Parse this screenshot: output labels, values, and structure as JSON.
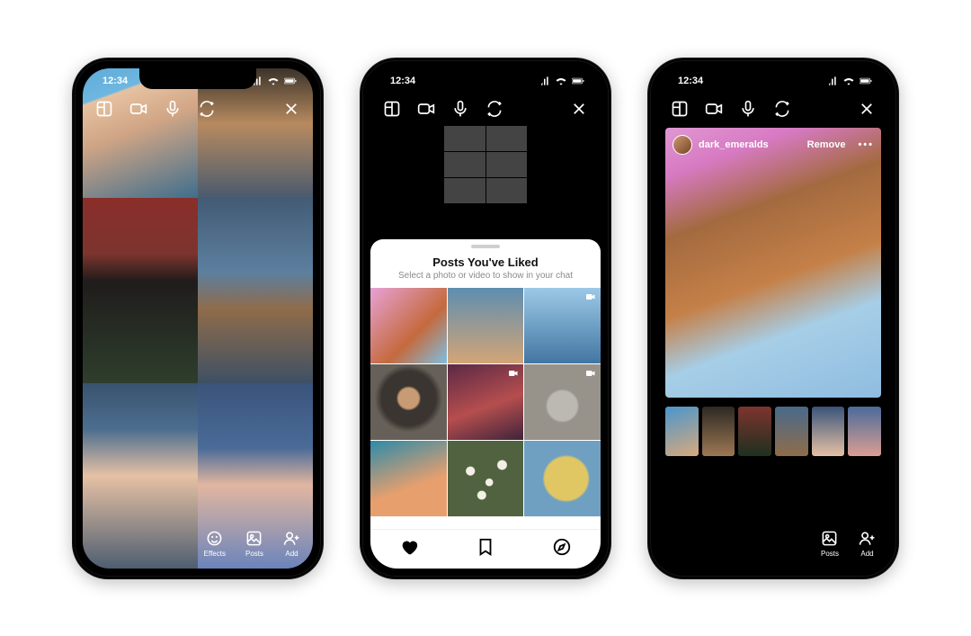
{
  "status": {
    "time": "12:34"
  },
  "toolbar_icons": {
    "layout": "layout-icon",
    "camera": "camera-icon",
    "mic": "mic-icon",
    "flip": "flip-camera-icon",
    "close": "close-icon"
  },
  "phone1": {
    "bottom": {
      "effects": "Effects",
      "posts": "Posts",
      "add": "Add"
    }
  },
  "phone2": {
    "sheet": {
      "title": "Posts You've Liked",
      "subtitle": "Select a photo or video to show in your chat"
    },
    "tabs": {
      "liked": "liked-tab",
      "saved": "saved-tab",
      "explore": "explore-tab"
    }
  },
  "phone3": {
    "post": {
      "username": "dark_emeralds",
      "remove": "Remove"
    },
    "bottom": {
      "posts": "Posts",
      "add": "Add"
    }
  }
}
